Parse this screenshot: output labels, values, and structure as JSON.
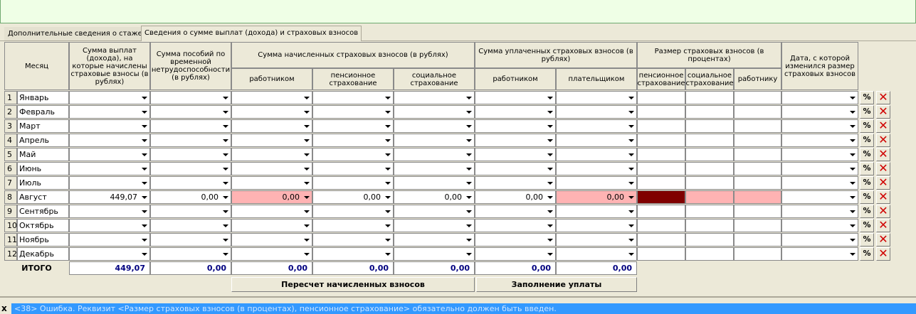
{
  "tabs": [
    {
      "label": "Дополнительные сведения о стаже"
    },
    {
      "label": "Сведения о сумме выплат (дохода) и страховых взносов"
    }
  ],
  "headers": {
    "month": "Месяц",
    "payments": "Сумма выплат (дохода), на которые начислены страховые взносы (в рублях)",
    "benefits": "Сумма пособий по временной нетрудоспособности (в рублях)",
    "accrued_group": "Сумма начисленных страховых взносов (в рублях)",
    "accrued_employee": "работником",
    "accrued_pension": "пенсионное страхование",
    "accrued_social": "социальное страхование",
    "paid_group": "Сумма уплаченных страховых взносов (в рублях)",
    "paid_employee": "работником",
    "paid_payer": "плательщиком",
    "rate_group": "Размер страховых взносов (в процентах)",
    "rate_pension": "пенсионное страхование",
    "rate_social": "социальное страхование",
    "rate_employee": "работнику",
    "date_changed": "Дата, с которой изменился размер страховых взносов"
  },
  "rows": [
    {
      "num": "1",
      "month": "Январь"
    },
    {
      "num": "2",
      "month": "Февраль"
    },
    {
      "num": "3",
      "month": "Март"
    },
    {
      "num": "4",
      "month": "Апрель"
    },
    {
      "num": "5",
      "month": "Май"
    },
    {
      "num": "6",
      "month": "Июнь"
    },
    {
      "num": "7",
      "month": "Июль"
    },
    {
      "num": "8",
      "month": "Август",
      "payments": "449,07",
      "benefits": "0,00",
      "accrued_employee": "0,00",
      "accrued_pension": "0,00",
      "accrued_social": "0,00",
      "paid_employee": "0,00",
      "paid_payer": "0,00"
    },
    {
      "num": "9",
      "month": "Сентябрь"
    },
    {
      "num": "10",
      "month": "Октябрь"
    },
    {
      "num": "11",
      "month": "Ноябрь"
    },
    {
      "num": "12",
      "month": "Декабрь"
    }
  ],
  "totals": {
    "label": "ИТОГО",
    "payments": "449,07",
    "benefits": "0,00",
    "accrued_employee": "0,00",
    "accrued_pension": "0,00",
    "accrued_social": "0,00",
    "paid_employee": "0,00",
    "paid_payer": "0,00"
  },
  "buttons": {
    "recalc": "Пересчет начисленных взносов",
    "fill_payment": "Заполнение уплаты",
    "row_pct_icon": "percent-icon",
    "row_delete_icon": "delete-x-icon"
  },
  "status": {
    "close": "x",
    "message": "<38> Ошибка. Реквизит <Размер страховых взносов (в процентах), пенсионное страхование> обязательно должен быть введен."
  },
  "colors": {
    "error_cell": "#ffb3b3",
    "selected_cell": "#800000",
    "status_bg": "#3399ff",
    "top_panel": "#efffe6",
    "delete_icon": "#d00000"
  }
}
